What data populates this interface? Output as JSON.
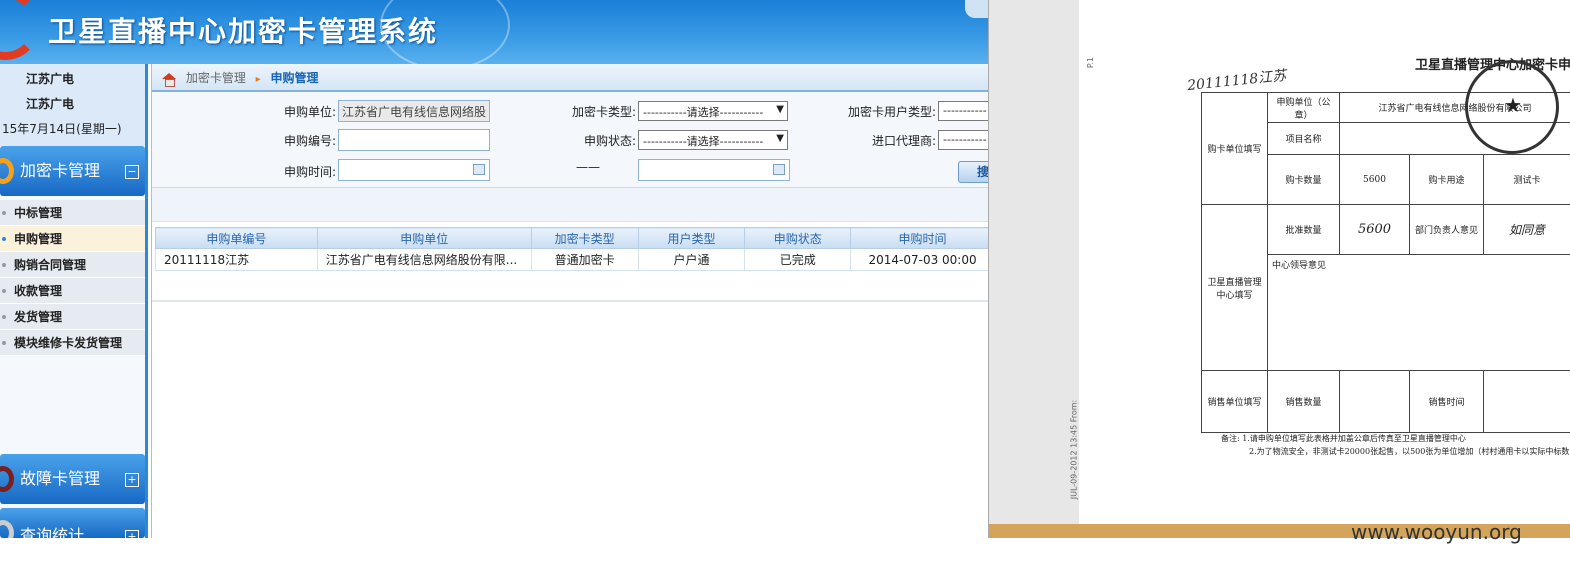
{
  "header": {
    "title": "卫星直播中心加密卡管理系统"
  },
  "sidebar": {
    "user_line1": "江苏广电",
    "user_line2": "江苏广电",
    "date": "15年7月14日(星期一)",
    "groups": [
      {
        "label": "加密卡管理",
        "toggle": "−"
      },
      {
        "label": "故障卡管理",
        "toggle": "+"
      },
      {
        "label": "查询统计",
        "toggle": "+"
      }
    ],
    "items": [
      "中标管理",
      "申购管理",
      "购销合同管理",
      "收款管理",
      "发货管理",
      "模块维修卡发货管理"
    ],
    "active_item": "申购管理"
  },
  "breadcrumb": {
    "parent": "加密卡管理",
    "current": "申购管理"
  },
  "filter": {
    "unit_label": "申购单位:",
    "unit_value": "江苏省广电有线信息网络股",
    "card_type_label": "加密卡类型:",
    "card_type_value": "-----------请选择-----------",
    "user_type_label": "加密卡用户类型:",
    "user_type_value": "-----------",
    "number_label": "申购编号:",
    "number_value": "",
    "status_label": "申购状态:",
    "status_value": "-----------请选择-----------",
    "agent_label": "进口代理商:",
    "agent_value": "-----------",
    "time_label": "申购时间:",
    "time_from": "",
    "time_to": "",
    "dash": "——",
    "search_button": "搜"
  },
  "table": {
    "columns": [
      "申购单编号",
      "申购单位",
      "加密卡类型",
      "用户类型",
      "申购状态",
      "申购时间"
    ],
    "rows": [
      [
        "20111118江苏",
        "江苏省广电有线信息网络股份有限...",
        "普通加密卡",
        "户户通",
        "已完成",
        "2014-07-03 00:00"
      ]
    ]
  },
  "document": {
    "page_no": "P.1",
    "side_text": "JUL-09-2012 13:45 From:",
    "title": "卫星直播管理中心加密卡申购",
    "handwritten_no": "20111118江苏",
    "rows": {
      "buyer_section": "购卡单位填写",
      "unit_label": "申购单位（公章）",
      "unit_value": "江苏省广电有线信息网络股份有限公司",
      "project_label": "项目名称",
      "qty_label": "购卡数量",
      "qty_value": "5600",
      "use_label": "购卡用途",
      "use_value": "测试卡",
      "center_section": "卫星直播管理中心填写",
      "approve_label": "批准数量",
      "approve_value": "5600",
      "dept_label": "部门负责人意见",
      "dept_value": "如同意",
      "leader_label": "中心领导意见",
      "sales_section": "销售单位填写",
      "sales_qty_label": "销售数量",
      "sales_time_label": "销售时间"
    },
    "note_label": "备注:",
    "note1": "1.请申购单位填写此表格并加盖公章后传真至卫星直播管理中心",
    "note2": "2.为了物流安全，非测试卡20000张起售，以500张为单位增加（村村通用卡以实际中标数"
  },
  "watermark": "www.wooyun.org",
  "colors": {
    "accent": "#1a7fd6",
    "header_text": "#ffffff",
    "active_row": "#fbf2dc",
    "crumb_current": "#1565b8"
  }
}
